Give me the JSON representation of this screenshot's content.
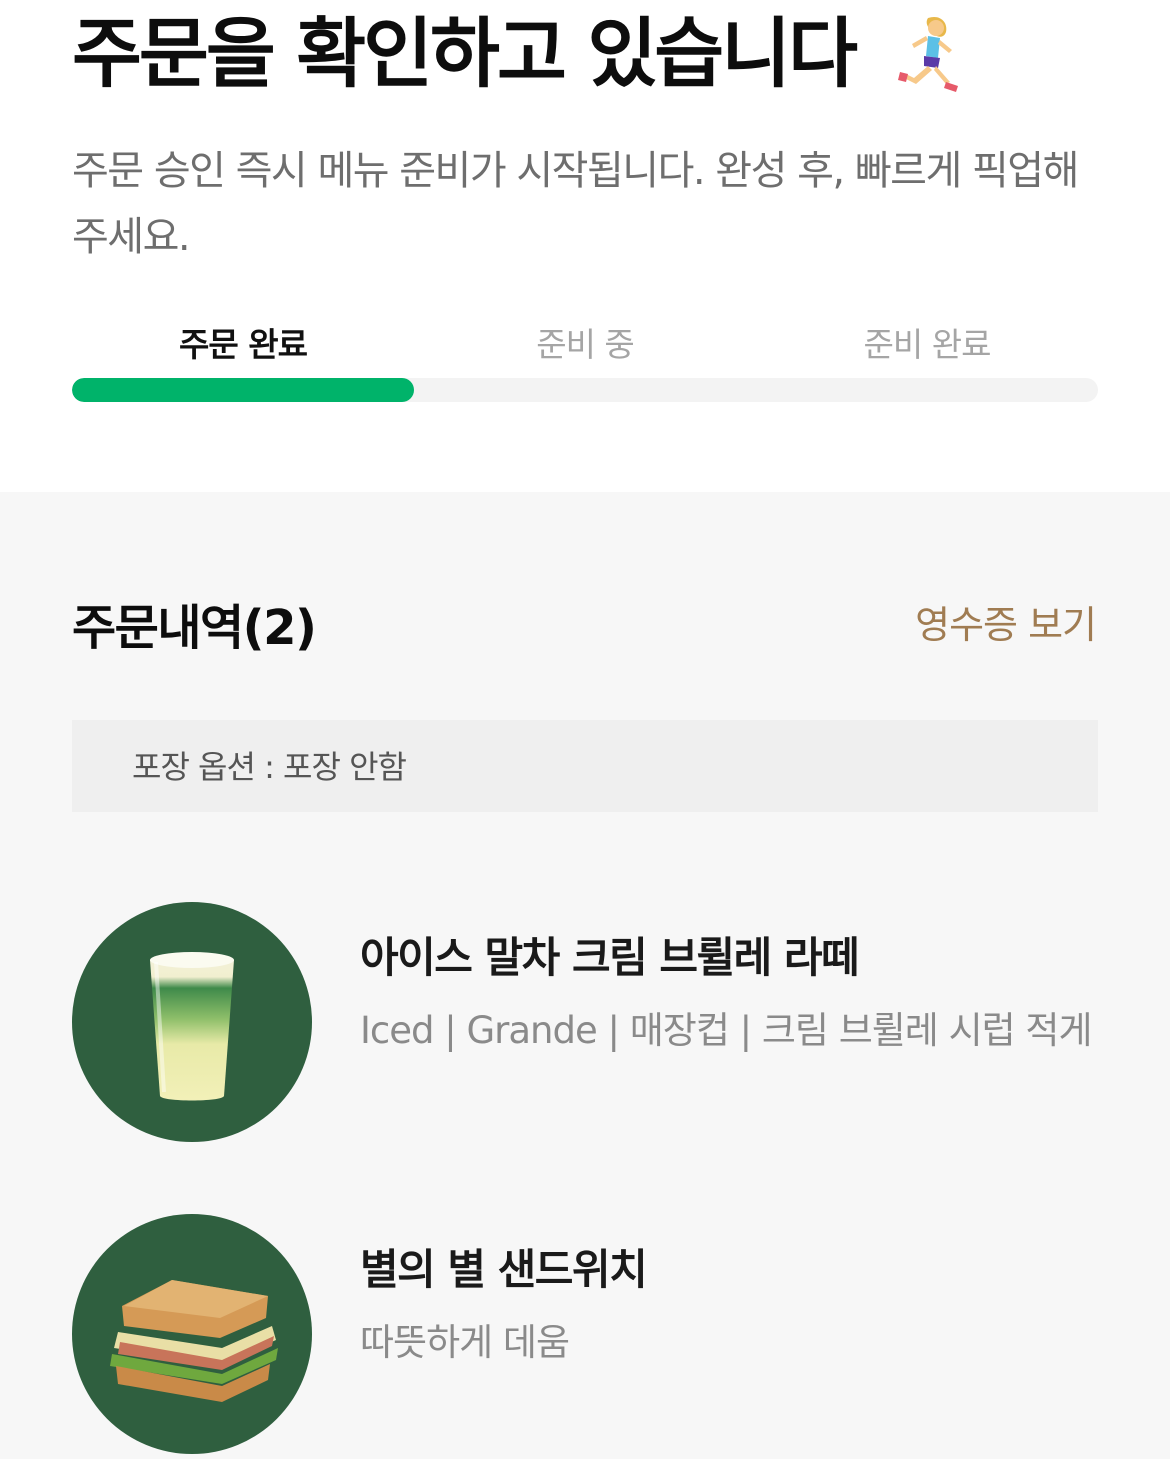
{
  "header": {
    "title": "주문을 확인하고 있습니다",
    "title_icon": "woman-running-icon",
    "subtitle": "주문 승인 즉시 메뉴 준비가 시작됩니다. 완성 후, 빠르게 픽업해 주세요."
  },
  "progress": {
    "steps": [
      "주문 완료",
      "준비 중",
      "준비 완료"
    ],
    "current_step_index": 0,
    "fill_fraction": 0.333,
    "accent_color": "#00b36a"
  },
  "order": {
    "title": "주문내역(2)",
    "receipt_link": "영수증 보기",
    "receipt_link_color": "#a07c52",
    "packaging_option": "포장 옵션 : 포장 안함",
    "items": [
      {
        "name": "아이스 말차 크림 브륄레 라떼",
        "options": "Iced | Grande | 매장컵 | 크림 브륄레 시럽 적게",
        "image": "matcha-latte-image"
      },
      {
        "name": "별의 별 샌드위치",
        "options": "따뜻하게 데움",
        "image": "sandwich-image"
      }
    ],
    "thumb_bg_color": "#2f5f3f"
  }
}
